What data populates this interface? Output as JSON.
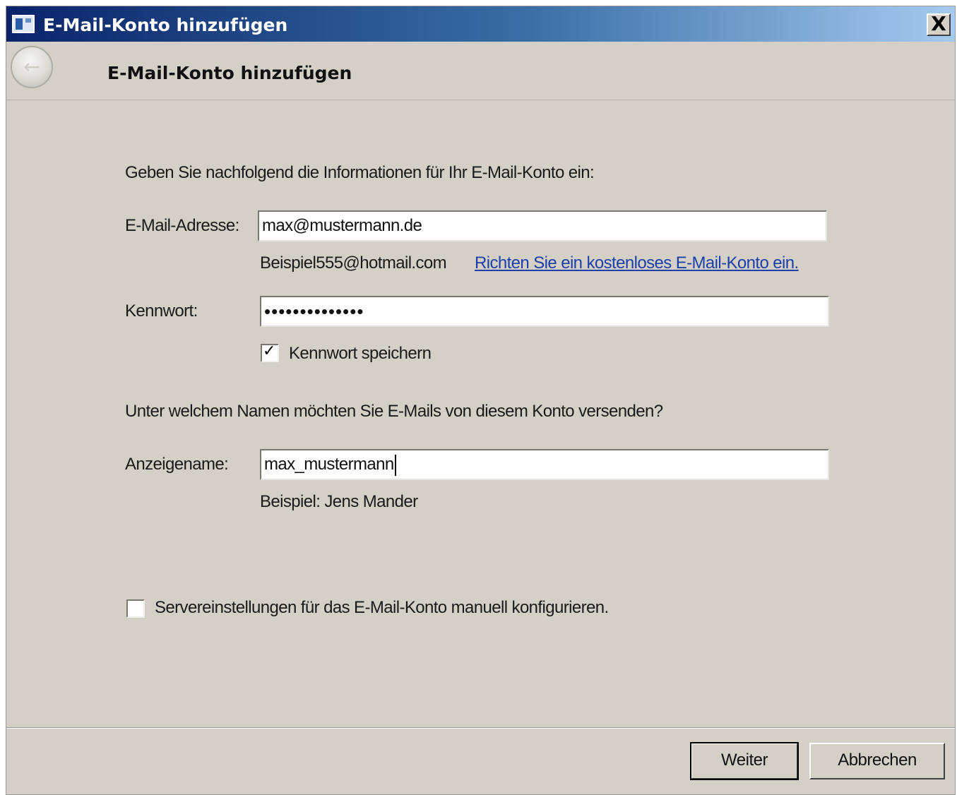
{
  "window": {
    "title": "E-Mail-Konto hinzufügen",
    "close_label": "X",
    "icon_name": "app-window-icon"
  },
  "header": {
    "back_icon": "back-arrow-icon",
    "back_glyph": "←",
    "title": "E-Mail-Konto hinzufügen"
  },
  "form": {
    "intro": "Geben Sie nachfolgend die Informationen für Ihr E-Mail-Konto ein:",
    "email_label": "E-Mail-Adresse:",
    "email_value": "max@mustermann.de",
    "email_example": "Beispiel555@hotmail.com",
    "free_account_link": "Richten Sie ein kostenloses E-Mail-Konto ein.",
    "password_label": "Kennwort:",
    "password_value": "••••••••••••••",
    "save_password_label": "Kennwort speichern",
    "save_password_checked": true,
    "display_question": "Unter welchem Namen möchten Sie E-Mails von diesem Konto versenden?",
    "display_name_label": "Anzeigename:",
    "display_name_value": "max_mustermann",
    "display_name_example": "Beispiel: Jens Mander",
    "manual_config_label": "Servereinstellungen für das E-Mail-Konto manuell konfigurieren.",
    "manual_config_checked": false
  },
  "buttons": {
    "next": "Weiter",
    "cancel": "Abbrechen"
  },
  "colors": {
    "dialog_bg": "#d4d0c8",
    "titlebar_start": "#0a246a",
    "titlebar_end": "#a6caf0",
    "link": "#1c3fa8"
  }
}
